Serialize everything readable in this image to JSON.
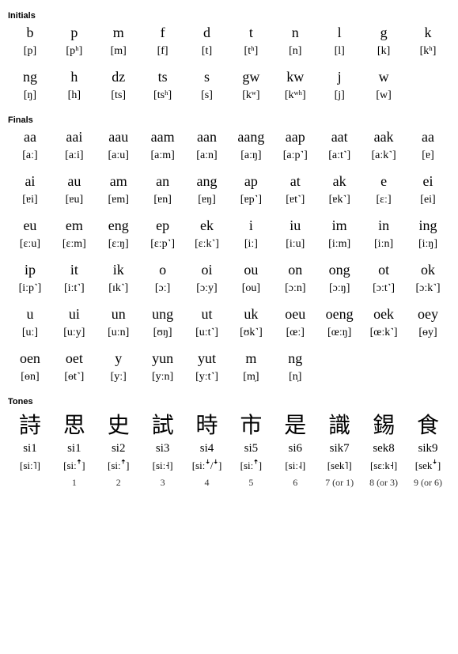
{
  "headers": {
    "initials": "Initials",
    "finals": "Finals",
    "tones": "Tones"
  },
  "initials": {
    "rows": [
      {
        "rom": [
          "b",
          "p",
          "m",
          "f",
          "d",
          "t",
          "n",
          "l",
          "g",
          "k"
        ],
        "ipa": [
          "[p]",
          "[pʰ]",
          "[m]",
          "[f]",
          "[t]",
          "[tʰ]",
          "[n]",
          "[l]",
          "[k]",
          "[kʰ]"
        ]
      },
      {
        "rom": [
          "ng",
          "h",
          "dz",
          "ts",
          "s",
          "gw",
          "kw",
          "j",
          "w",
          ""
        ],
        "ipa": [
          "[ŋ]",
          "[h]",
          "[ts]",
          "[tsʰ]",
          "[s]",
          "[kʷ]",
          "[kʷʰ]",
          "[j]",
          "[w]",
          ""
        ]
      }
    ]
  },
  "finals": {
    "rows": [
      {
        "rom": [
          "aa",
          "aai",
          "aau",
          "aam",
          "aan",
          "aang",
          "aap",
          "aat",
          "aak",
          "aa"
        ],
        "ipa": [
          "[aː]",
          "[aːi]",
          "[aːu]",
          "[aːm]",
          "[aːn]",
          "[aːŋ]",
          "[aːp˺]",
          "[aːt˺]",
          "[aːk˺]",
          "[ɐ]"
        ]
      },
      {
        "rom": [
          "ai",
          "au",
          "am",
          "an",
          "ang",
          "ap",
          "at",
          "ak",
          "e",
          "ei"
        ],
        "ipa": [
          "[ɐi]",
          "[ɐu]",
          "[ɐm]",
          "[ɐn]",
          "[ɐŋ]",
          "[ɐp˺]",
          "[ɐt˺]",
          "[ɐk˺]",
          "[ɛː]",
          "[ei]"
        ]
      },
      {
        "rom": [
          "eu",
          "em",
          "eng",
          "ep",
          "ek",
          "i",
          "iu",
          "im",
          "in",
          "ing"
        ],
        "ipa": [
          "[ɛːu]",
          "[ɛːm]",
          "[ɛːŋ]",
          "[ɛːp˺]",
          "[ɛːk˺]",
          "[iː]",
          "[iːu]",
          "[iːm]",
          "[iːn]",
          "[iːŋ]"
        ]
      },
      {
        "rom": [
          "ip",
          "it",
          "ik",
          "o",
          "oi",
          "ou",
          "on",
          "ong",
          "ot",
          "ok"
        ],
        "ipa": [
          "[iːp˺]",
          "[iːt˺]",
          "[ɪk˺]",
          "[ɔː]",
          "[ɔːy]",
          "[ou]",
          "[ɔːn]",
          "[ɔːŋ]",
          "[ɔːt˺]",
          "[ɔːk˺]"
        ]
      },
      {
        "rom": [
          "u",
          "ui",
          "un",
          "ung",
          "ut",
          "uk",
          "oeu",
          "oeng",
          "oek",
          "oey"
        ],
        "ipa": [
          "[uː]",
          "[uːy]",
          "[uːn]",
          "[ʊŋ]",
          "[uːt˺]",
          "[ʊk˺]",
          "[œː]",
          "[œːŋ]",
          "[œːk˺]",
          "[ɵy]"
        ]
      },
      {
        "rom": [
          "oen",
          "oet",
          "y",
          "yun",
          "yut",
          "m",
          "ng",
          "",
          "",
          ""
        ],
        "ipa": [
          "[ɵn]",
          "[ɵt˺]",
          "[yː]",
          "[yːn]",
          "[yːt˺]",
          "[m̩]",
          "[n̩]",
          "",
          "",
          ""
        ]
      }
    ]
  },
  "tones": {
    "chars": [
      "詩",
      "思",
      "史",
      "試",
      "時",
      "市",
      "是",
      "識",
      "錫",
      "食"
    ],
    "rom": [
      "si1",
      "si1",
      "si2",
      "si3",
      "si4",
      "si5",
      "si6",
      "sik7",
      "sek8",
      "sik9"
    ],
    "ipa": [
      "[siː˥]",
      "[siːꜛ]",
      "[siːꜛ]",
      "[siː˧]",
      "[siːꜜ/ꜜ]",
      "[siːꜛ]",
      "[siː˨]",
      "[sek˥]",
      "[sɛːk˧]",
      "[sekꜜ]"
    ],
    "nums": [
      "1",
      "2",
      "3",
      "4",
      "5",
      "6",
      "7 (or 1)",
      "8 (or 3)",
      "9 (or 6)"
    ]
  },
  "chart_data": [
    {
      "type": "table",
      "title": "Initials",
      "series": [
        {
          "name": "Romanization",
          "values": [
            "b",
            "p",
            "m",
            "f",
            "d",
            "t",
            "n",
            "l",
            "g",
            "k",
            "ng",
            "h",
            "dz",
            "ts",
            "s",
            "gw",
            "kw",
            "j",
            "w"
          ]
        },
        {
          "name": "IPA",
          "values": [
            "[p]",
            "[pʰ]",
            "[m]",
            "[f]",
            "[t]",
            "[tʰ]",
            "[n]",
            "[l]",
            "[k]",
            "[kʰ]",
            "[ŋ]",
            "[h]",
            "[ts]",
            "[tsʰ]",
            "[s]",
            "[kʷ]",
            "[kʷʰ]",
            "[j]",
            "[w]"
          ]
        }
      ]
    },
    {
      "type": "table",
      "title": "Finals",
      "series": [
        {
          "name": "Romanization",
          "values": [
            "aa",
            "aai",
            "aau",
            "aam",
            "aan",
            "aang",
            "aap",
            "aat",
            "aak",
            "aa",
            "ai",
            "au",
            "am",
            "an",
            "ang",
            "ap",
            "at",
            "ak",
            "e",
            "ei",
            "eu",
            "em",
            "eng",
            "ep",
            "ek",
            "i",
            "iu",
            "im",
            "in",
            "ing",
            "ip",
            "it",
            "ik",
            "o",
            "oi",
            "ou",
            "on",
            "ong",
            "ot",
            "ok",
            "u",
            "ui",
            "un",
            "ung",
            "ut",
            "uk",
            "oeu",
            "oeng",
            "oek",
            "oey",
            "oen",
            "oet",
            "y",
            "yun",
            "yut",
            "m",
            "ng"
          ]
        },
        {
          "name": "IPA",
          "values": [
            "[aː]",
            "[aːi]",
            "[aːu]",
            "[aːm]",
            "[aːn]",
            "[aːŋ]",
            "[aːp˺]",
            "[aːt˺]",
            "[aːk˺]",
            "[ɐ]",
            "[ɐi]",
            "[ɐu]",
            "[ɐm]",
            "[ɐn]",
            "[ɐŋ]",
            "[ɐp˺]",
            "[ɐt˺]",
            "[ɐk˺]",
            "[ɛː]",
            "[ei]",
            "[ɛːu]",
            "[ɛːm]",
            "[ɛːŋ]",
            "[ɛːp˺]",
            "[ɛːk˺]",
            "[iː]",
            "[iːu]",
            "[iːm]",
            "[iːn]",
            "[iːŋ]",
            "[iːp˺]",
            "[iːt˺]",
            "[ɪk˺]",
            "[ɔː]",
            "[ɔːy]",
            "[ou]",
            "[ɔːn]",
            "[ɔːŋ]",
            "[ɔːt˺]",
            "[ɔːk˺]",
            "[uː]",
            "[uːy]",
            "[uːn]",
            "[ʊŋ]",
            "[uːt˺]",
            "[ʊk˺]",
            "[œː]",
            "[œːŋ]",
            "[œːk˺]",
            "[ɵy]",
            "[ɵn]",
            "[ɵt˺]",
            "[yː]",
            "[yːn]",
            "[yːt˺]",
            "[m̩]",
            "[n̩]"
          ]
        }
      ]
    },
    {
      "type": "table",
      "title": "Tones",
      "series": [
        {
          "name": "Character",
          "values": [
            "詩",
            "思",
            "史",
            "試",
            "時",
            "市",
            "是",
            "識",
            "錫",
            "食"
          ]
        },
        {
          "name": "Romanization",
          "values": [
            "si1",
            "si1",
            "si2",
            "si3",
            "si4",
            "si5",
            "si6",
            "sik7",
            "sek8",
            "sik9"
          ]
        },
        {
          "name": "IPA",
          "values": [
            "[siː˥]",
            "[siːꜛ]",
            "[siːꜛ]",
            "[siː˧]",
            "[siːꜜ/ꜜ]",
            "[siːꜛ]",
            "[siː˨]",
            "[sek˥]",
            "[sɛːk˧]",
            "[sekꜜ]"
          ]
        },
        {
          "name": "Tone number",
          "values": [
            "1",
            "2",
            "3",
            "4",
            "5",
            "6",
            "7 (or 1)",
            "8 (or 3)",
            "9 (or 6)"
          ]
        }
      ]
    }
  ]
}
